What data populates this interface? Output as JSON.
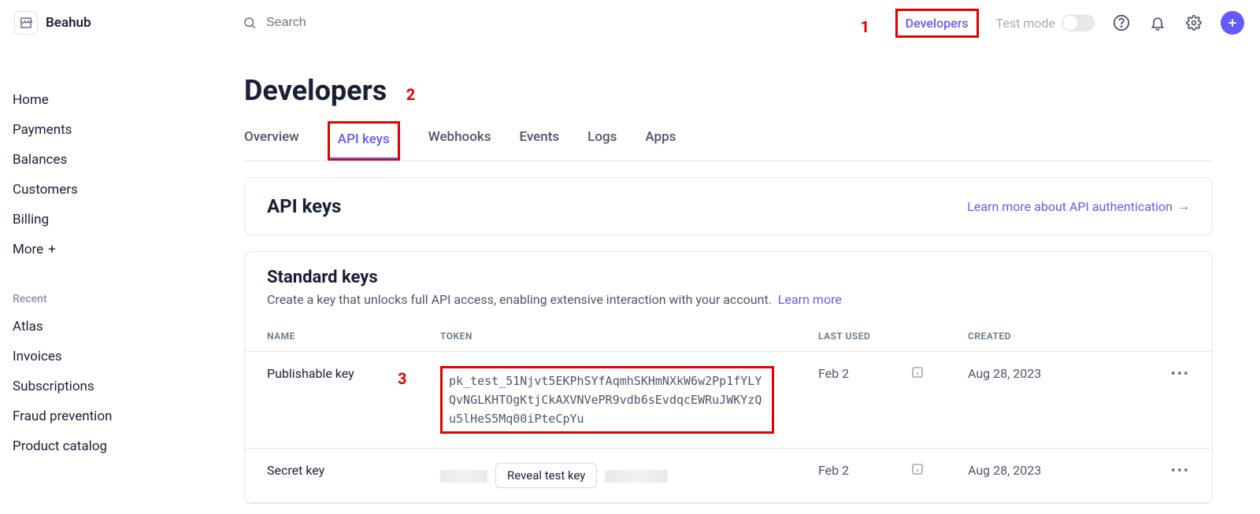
{
  "brand": {
    "name": "Beahub"
  },
  "search": {
    "placeholder": "Search"
  },
  "header": {
    "developers_link": "Developers",
    "test_mode_label": "Test mode"
  },
  "callouts": {
    "c1": "1",
    "c2": "2",
    "c3": "3"
  },
  "sidebar": {
    "items": [
      {
        "label": "Home"
      },
      {
        "label": "Payments"
      },
      {
        "label": "Balances"
      },
      {
        "label": "Customers"
      },
      {
        "label": "Billing"
      },
      {
        "label": "More"
      }
    ],
    "recent_label": "Recent",
    "recent": [
      {
        "label": "Atlas"
      },
      {
        "label": "Invoices"
      },
      {
        "label": "Subscriptions"
      },
      {
        "label": "Fraud prevention"
      },
      {
        "label": "Product catalog"
      }
    ]
  },
  "page": {
    "title": "Developers",
    "tabs": [
      {
        "label": "Overview"
      },
      {
        "label": "API keys"
      },
      {
        "label": "Webhooks"
      },
      {
        "label": "Events"
      },
      {
        "label": "Logs"
      },
      {
        "label": "Apps"
      }
    ]
  },
  "api_keys_card": {
    "title": "API keys",
    "learn_link": "Learn more about API authentication"
  },
  "standard_keys": {
    "title": "Standard keys",
    "description": "Create a key that unlocks full API access, enabling extensive interaction with your account.",
    "learn_more": "Learn more",
    "columns": {
      "name": "NAME",
      "token": "TOKEN",
      "last_used": "LAST USED",
      "created": "CREATED"
    },
    "rows": [
      {
        "name": "Publishable key",
        "token": "pk_test_51Njvt5EKPhSYfAqmhSKHmNXkW6w2Pp1fYLYQvNGLKHTOgKtjCkAXVNVePR9vdb6sEvdqcEWRuJWKYzQu5lHeS5Mq00iPteCpYu",
        "last_used": "Feb 2",
        "created": "Aug 28, 2023"
      },
      {
        "name": "Secret key",
        "reveal_label": "Reveal test key",
        "last_used": "Feb 2",
        "created": "Aug 28, 2023"
      }
    ]
  }
}
